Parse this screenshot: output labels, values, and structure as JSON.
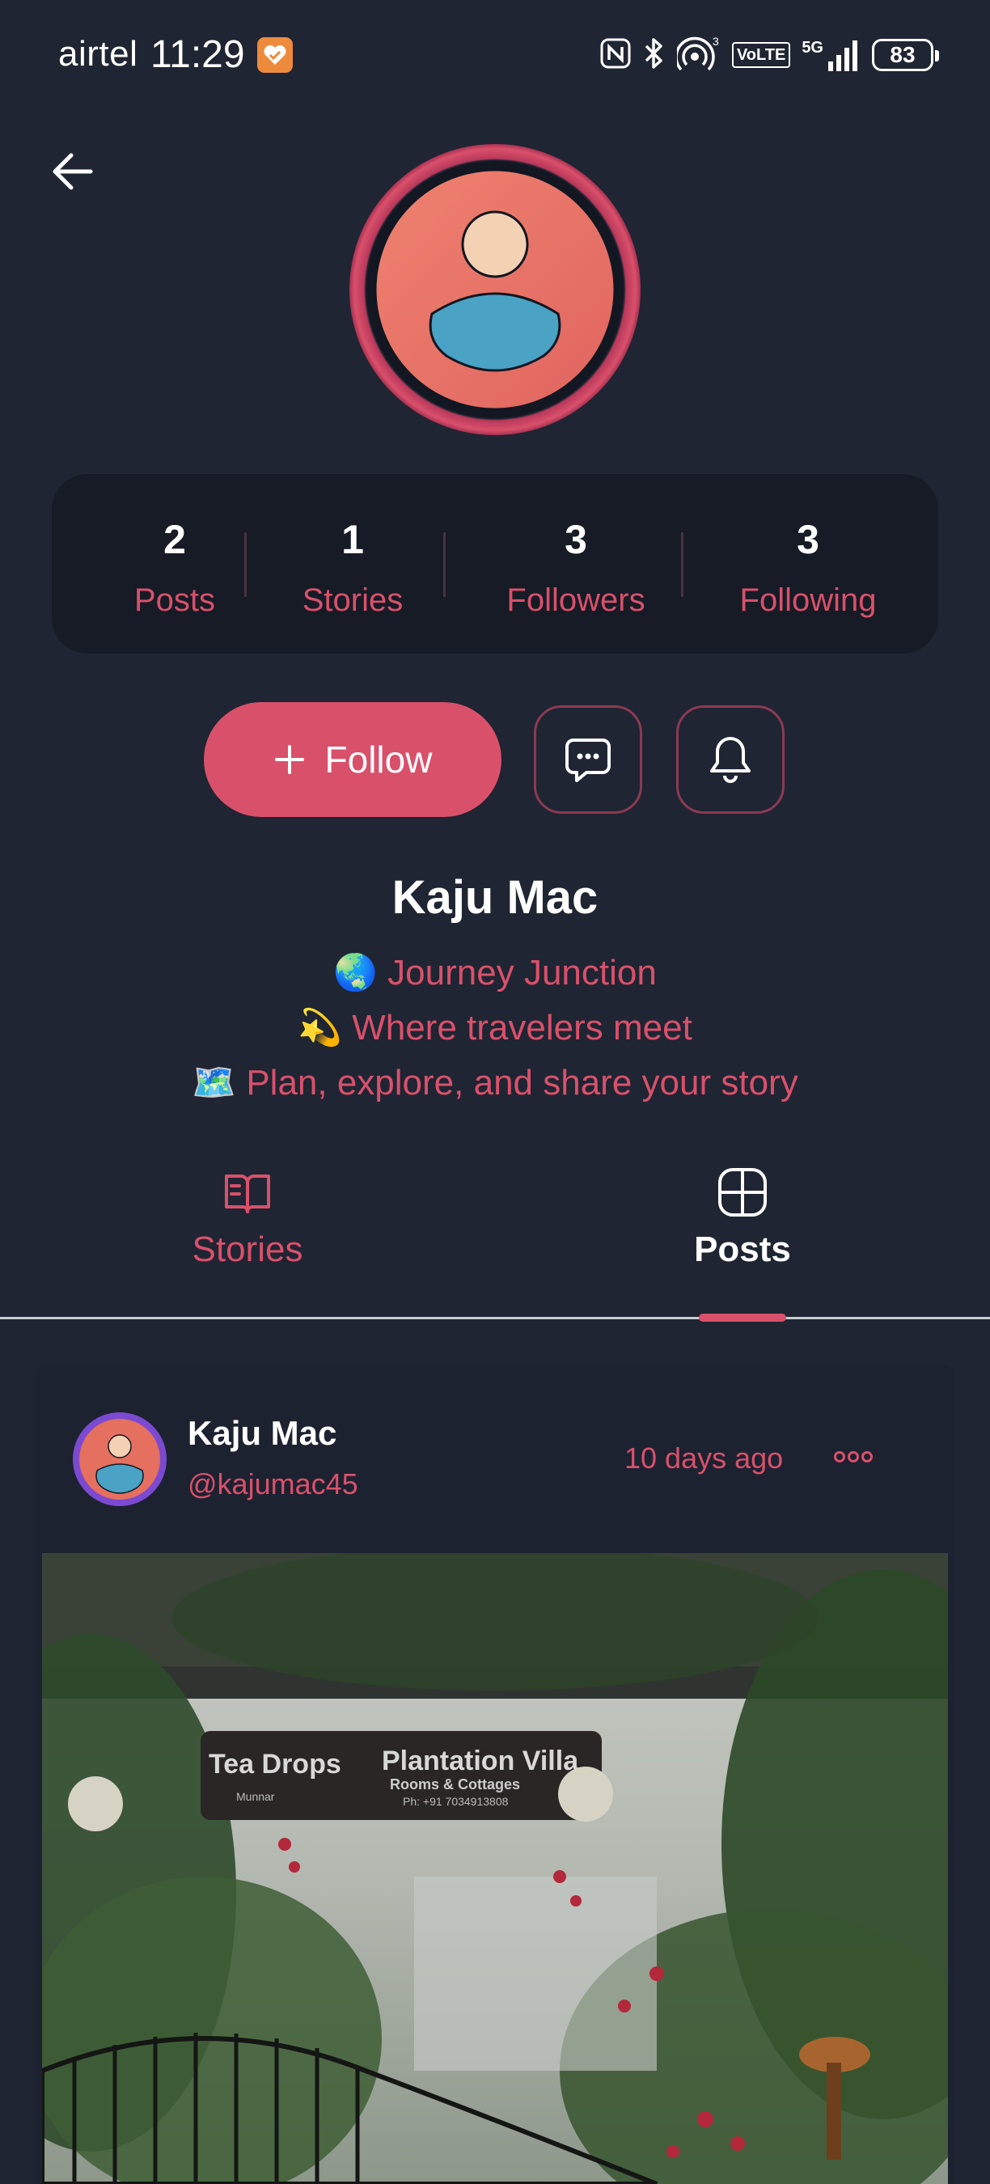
{
  "status_bar": {
    "carrier": "airtel",
    "time": "11:29",
    "volte_label": "VoLTE",
    "network_label": "5G",
    "signal_sup": "3",
    "battery": "83"
  },
  "profile": {
    "stats": [
      {
        "value": "2",
        "label": "Posts"
      },
      {
        "value": "1",
        "label": "Stories"
      },
      {
        "value": "3",
        "label": "Followers"
      },
      {
        "value": "3",
        "label": "Following"
      }
    ],
    "follow_label": "Follow",
    "name": "Kaju Mac",
    "bio": [
      "🌏 Journey Junction",
      "💫 Where travelers meet",
      "🗺️ Plan, explore, and share your story"
    ]
  },
  "tabs": [
    {
      "label": "Stories",
      "active": false
    },
    {
      "label": "Posts",
      "active": true
    }
  ],
  "post": {
    "author": "Kaju Mac",
    "handle": "@kajumac45",
    "time": "10 days ago",
    "sign_left": "Tea Drops",
    "sign_left_sub": "Munnar",
    "sign_right": "Plantation Villa",
    "sign_right_sub": "Rooms & Cottages",
    "sign_phone": "Ph: +91 7034913808"
  },
  "colors": {
    "background": "#1f2532",
    "accent": "#d9506b",
    "card": "#161b25"
  }
}
